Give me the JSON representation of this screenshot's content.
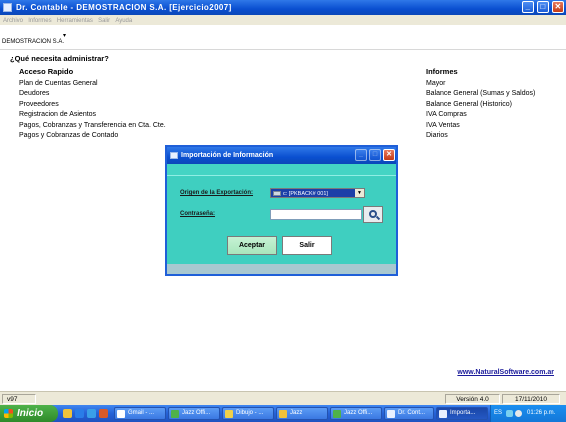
{
  "window": {
    "title": "Dr. Contable - DEMOSTRACION S.A.  [Ejercicio2007]",
    "minimize_glyph": "_",
    "maximize_glyph": "□",
    "close_glyph": "✕"
  },
  "menu": [
    "Archivo",
    "Informes",
    "Herramientas",
    "Salir",
    "Ayuda"
  ],
  "company": {
    "name": "DEMOSTRACION S.A.",
    "caret": "▾"
  },
  "main": {
    "question": "¿Qué necesita administrar?",
    "quick_access": {
      "heading": "Acceso Rapido",
      "items": [
        "Plan de Cuentas General",
        "Deudores",
        "Proveedores",
        "Registracion de Asientos",
        "Pagos, Cobranzas y Transferencia en Cta. Cte.",
        "Pagos y Cobranzas de Contado"
      ]
    },
    "reports": {
      "heading": "Informes",
      "items": [
        "Mayor",
        "Balance General (Sumas y Saldos)",
        "Balance General (Historico)",
        "IVA Compras",
        "IVA Ventas",
        "Diarios"
      ]
    },
    "website": "www.NaturalSoftware.com.ar"
  },
  "status": {
    "version_code": "v97",
    "version": "Versión 4.0",
    "date": "17/11/2010"
  },
  "taskbar": {
    "start": "Inicio",
    "tasks": [
      "Gmail - ...",
      "Jazz Offi...",
      "Dibujo - ...",
      "Jazz",
      "Jazz Offi...",
      "Dr. Cont...",
      "Importa..."
    ],
    "language": "ES",
    "time": "01:26 p.m."
  },
  "dialog": {
    "title": "Importación de Información",
    "origin_label": "Origen de la Exportación:",
    "origin_value": "c: [PKBACK# 001]",
    "password_label": "Contraseña:",
    "password_value": "",
    "accept": "Aceptar",
    "exit": "Salir",
    "close_glyph": "✕",
    "min_glyph": "_",
    "max_glyph": "□",
    "arrow_glyph": "▼"
  }
}
